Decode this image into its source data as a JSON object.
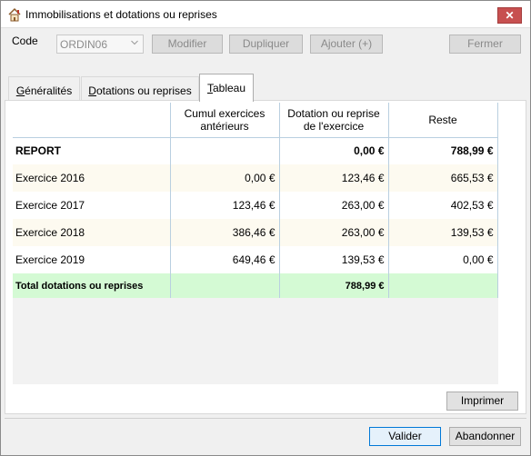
{
  "window": {
    "title": "Immobilisations et dotations ou reprises",
    "close_label": "✕"
  },
  "toolbar": {
    "code_label": "Code",
    "code_value": "ORDIN06",
    "modifier_label": "Modifier",
    "dupliquer_label": "Dupliquer",
    "ajouter_label": "Ajouter (+)",
    "fermer_label": "Fermer"
  },
  "tabs": [
    {
      "label": "Généralités",
      "underline_char": "G",
      "rest": "énéralités"
    },
    {
      "label": "Dotations ou reprises",
      "underline_char": "D",
      "rest": "otations ou reprises"
    },
    {
      "label": "Tableau",
      "underline_char": "T",
      "rest": "ableau"
    }
  ],
  "table": {
    "columns": [
      "",
      "Cumul exercices antérieurs",
      "Dotation ou reprise de l'exercice",
      "Reste"
    ],
    "col_header_lines": [
      [
        "",
        ""
      ],
      [
        "Cumul exercices",
        "antérieurs"
      ],
      [
        "Dotation ou reprise",
        "de l'exercice"
      ],
      [
        "Reste",
        ""
      ]
    ],
    "rows": [
      {
        "label": "REPORT",
        "cumul": "",
        "dotation": "0,00 €",
        "reste": "788,99 €",
        "style": "bold"
      },
      {
        "label": "Exercice 2016",
        "cumul": "0,00 €",
        "dotation": "123,46 €",
        "reste": "665,53 €",
        "style": "beige"
      },
      {
        "label": "Exercice 2017",
        "cumul": "123,46 €",
        "dotation": "263,00 €",
        "reste": "402,53 €",
        "style": "white"
      },
      {
        "label": "Exercice 2018",
        "cumul": "386,46 €",
        "dotation": "263,00 €",
        "reste": "139,53 €",
        "style": "beige"
      },
      {
        "label": "Exercice 2019",
        "cumul": "649,46 €",
        "dotation": "139,53 €",
        "reste": "0,00 €",
        "style": "white"
      },
      {
        "label": "Total dotations ou reprises",
        "cumul": "",
        "dotation": "788,99 €",
        "reste": "",
        "style": "total"
      }
    ]
  },
  "buttons": {
    "imprimer_label": "Imprimer",
    "valider_label": "Valider",
    "abandonner_label": "Abandonner"
  },
  "colors": {
    "total_row": "#d4fad4",
    "alt_row": "#fdfaf0",
    "close_button": "#c75050",
    "default_button_border": "#0078d7"
  }
}
